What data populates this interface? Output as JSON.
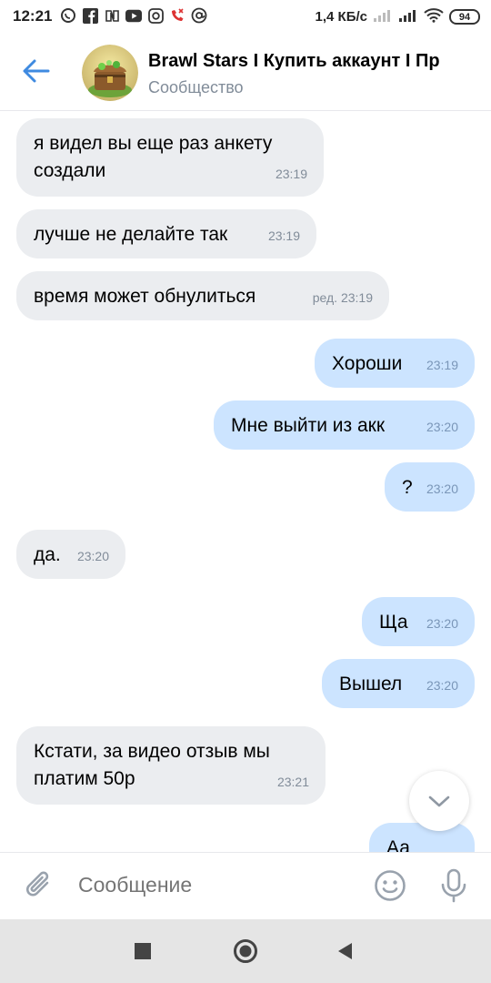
{
  "status_bar": {
    "time": "12:21",
    "speed": "1,4 КБ/с",
    "battery": "94"
  },
  "header": {
    "title": "Brawl Stars I Купить аккаунт I Пр",
    "subtitle": "Сообщество"
  },
  "messages": [
    {
      "side": "in",
      "text": "я видел вы еще раз анкету\nсоздали",
      "time": "23:19"
    },
    {
      "side": "in",
      "text": "лучше не делайте так",
      "time": "23:19"
    },
    {
      "side": "in",
      "text": "время может обнулиться",
      "time": "ред. 23:19"
    },
    {
      "side": "out",
      "text": "Хороши",
      "time": "23:19"
    },
    {
      "side": "out",
      "text": "Мне выйти из акк",
      "time": "23:20"
    },
    {
      "side": "out",
      "text": "?",
      "time": "23:20"
    },
    {
      "side": "in",
      "text": "да.",
      "time": "23:20"
    },
    {
      "side": "out",
      "text": "Ща",
      "time": "23:20"
    },
    {
      "side": "out",
      "text": "Вышел",
      "time": "23:20"
    },
    {
      "side": "in",
      "text": "Кстати, за видео отзыв мы\nплатим 50р",
      "time": "23:21"
    },
    {
      "side": "out",
      "text": "Аа",
      "time": ""
    }
  ],
  "composer": {
    "placeholder": "Сообщение"
  },
  "colors": {
    "accent": "#3f8ae0",
    "incoming_bubble": "#ebedf0",
    "outgoing_bubble": "#cce4ff"
  },
  "icons": [
    "back-arrow-icon",
    "attach-icon",
    "emoji-icon",
    "mic-icon",
    "chevron-down-icon",
    "nav-recents-icon",
    "nav-home-icon",
    "nav-back-icon"
  ]
}
